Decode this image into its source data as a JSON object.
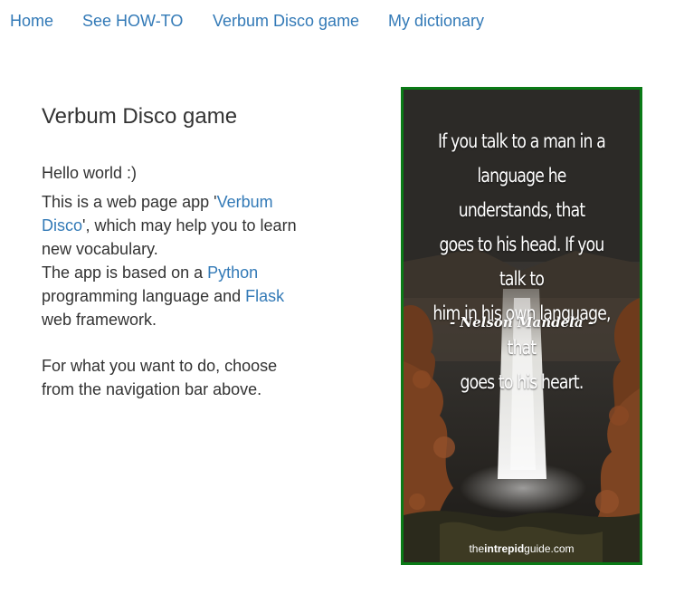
{
  "nav": {
    "items": [
      {
        "label": "Home"
      },
      {
        "label": "See HOW-TO"
      },
      {
        "label": "Verbum Disco game"
      },
      {
        "label": "My dictionary"
      }
    ]
  },
  "main": {
    "title": "Verbum Disco game",
    "hello": "Hello world :)",
    "intro_before": "This is a web page app '",
    "app_link": "Verbum Disco",
    "intro_after": "', which may help you to learn new vocabulary.",
    "based_before": "The app is based on a ",
    "python_link": "Python",
    "based_middle": " programming language and ",
    "flask_link": "Flask",
    "based_after": " web framework.",
    "instructions": "For what you want to do, choose from the navigation bar above."
  },
  "quote_image": {
    "lines": [
      "If you talk to a man in a",
      "language he understands, that",
      "goes to his head. If you talk to",
      "him in his own language, that",
      "goes to his heart."
    ],
    "author": "- Nelson Mandela -",
    "watermark_pre": "the",
    "watermark_bold": "intrepid",
    "watermark_post": "guide.com",
    "border_color": "#0a7a16"
  },
  "colors": {
    "link": "#337ab7",
    "text": "#333333"
  }
}
